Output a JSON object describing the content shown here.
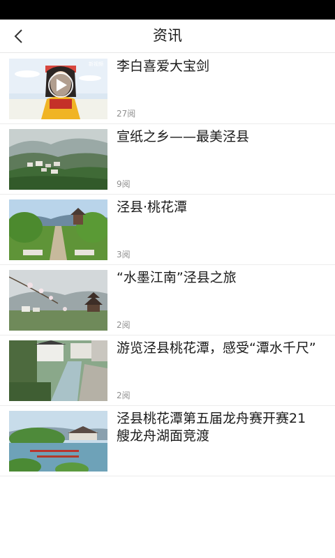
{
  "header": {
    "title": "资讯",
    "back_icon": "chevron-left-icon"
  },
  "news": [
    {
      "title": "李白喜爱大宝剑",
      "reads": "27阅",
      "thumb": "video-cartoon-thumbnail",
      "watermark": "新视频"
    },
    {
      "title": "宣纸之乡——最美泾县",
      "reads": "9阅",
      "thumb": "mountain-village-photo"
    },
    {
      "title": "泾县·桃花潭",
      "reads": "3阅",
      "thumb": "garden-path-photo"
    },
    {
      "title": "“水墨江南”泾县之旅",
      "reads": "2阅",
      "thumb": "pavilion-blossom-photo"
    },
    {
      "title": "游览泾县桃花潭，感受“潭水千尺”",
      "reads": "2阅",
      "thumb": "old-town-river-photo"
    },
    {
      "title": "泾县桃花潭第五届龙舟赛开赛21艘龙舟湖面竞渡",
      "reads": "",
      "thumb": "dragon-boat-lake-photo"
    }
  ]
}
